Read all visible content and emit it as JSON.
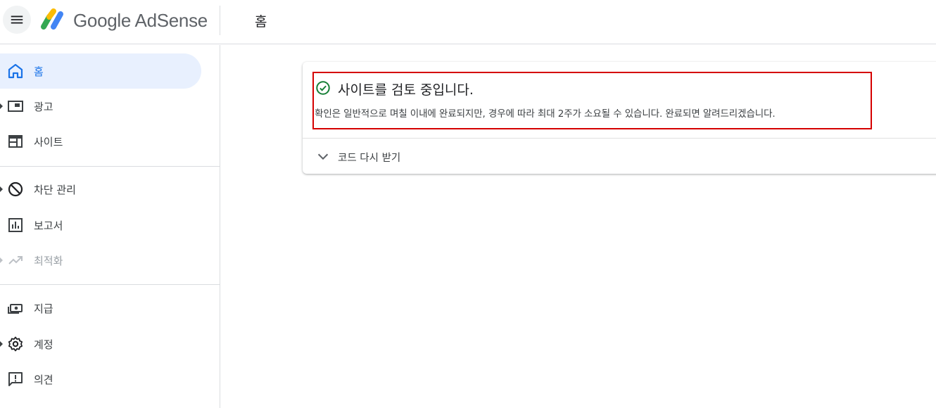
{
  "header": {
    "menu_icon": "hamburger-menu-icon",
    "logo_text": "Google AdSense",
    "title": "홈"
  },
  "sidebar": {
    "items": [
      {
        "label": "홈",
        "icon": "home-icon",
        "active": true
      },
      {
        "label": "광고",
        "icon": "ads-icon"
      },
      {
        "label": "사이트",
        "icon": "sites-icon"
      },
      {
        "label": "차단 관리",
        "icon": "block-icon"
      },
      {
        "label": "보고서",
        "icon": "reports-icon"
      },
      {
        "label": "최적화",
        "icon": "trending-up-icon",
        "disabled": true
      },
      {
        "label": "지급",
        "icon": "payments-icon"
      },
      {
        "label": "계정",
        "icon": "settings-icon"
      },
      {
        "label": "의견",
        "icon": "feedback-icon"
      }
    ]
  },
  "main": {
    "card": {
      "title": "사이트를 검토 중입니다.",
      "description": "확인은 일반적으로 며칠 이내에 완료되지만, 경우에 따라 최대 2주가 소요될 수 있습니다. 완료되면 알려드리겠습니다.",
      "expand_label": "코드 다시 받기"
    }
  },
  "colors": {
    "accent": "#1a73e8",
    "active_bg": "#e8f0fe",
    "success": "#188038",
    "highlight_border": "#d50000"
  }
}
